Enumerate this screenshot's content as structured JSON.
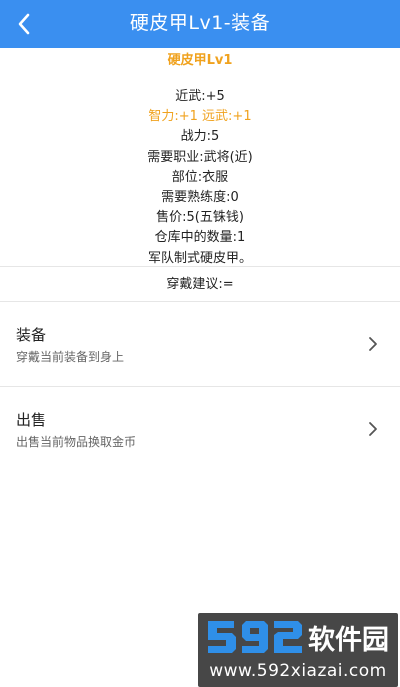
{
  "header": {
    "title": "硬皮甲Lv1-装备",
    "background": "#3a8ff0"
  },
  "item": {
    "name": "硬皮甲Lv1",
    "name_color": "#f0a21e",
    "stats": [
      {
        "text": "近武:+5",
        "highlight": false
      },
      {
        "text": "智力:+1 远武:+1",
        "highlight": true
      },
      {
        "text": "战力:5",
        "highlight": false
      },
      {
        "text": "需要职业:武将(近)",
        "highlight": false
      },
      {
        "text": "部位:衣服",
        "highlight": false
      },
      {
        "text": "需要熟练度:0",
        "highlight": false
      },
      {
        "text": "售价:5(五铢钱)",
        "highlight": false
      },
      {
        "text": "仓库中的数量:1",
        "highlight": false
      },
      {
        "text": "军队制式硬皮甲。",
        "highlight": false
      }
    ]
  },
  "suggestion": "穿戴建议:=",
  "actions": [
    {
      "title": "装备",
      "subtitle": "穿戴当前装备到身上"
    },
    {
      "title": "出售",
      "subtitle": "出售当前物品换取金币"
    }
  ],
  "watermark": {
    "brand": "592软件园",
    "url": "www.592xiazai.com"
  }
}
